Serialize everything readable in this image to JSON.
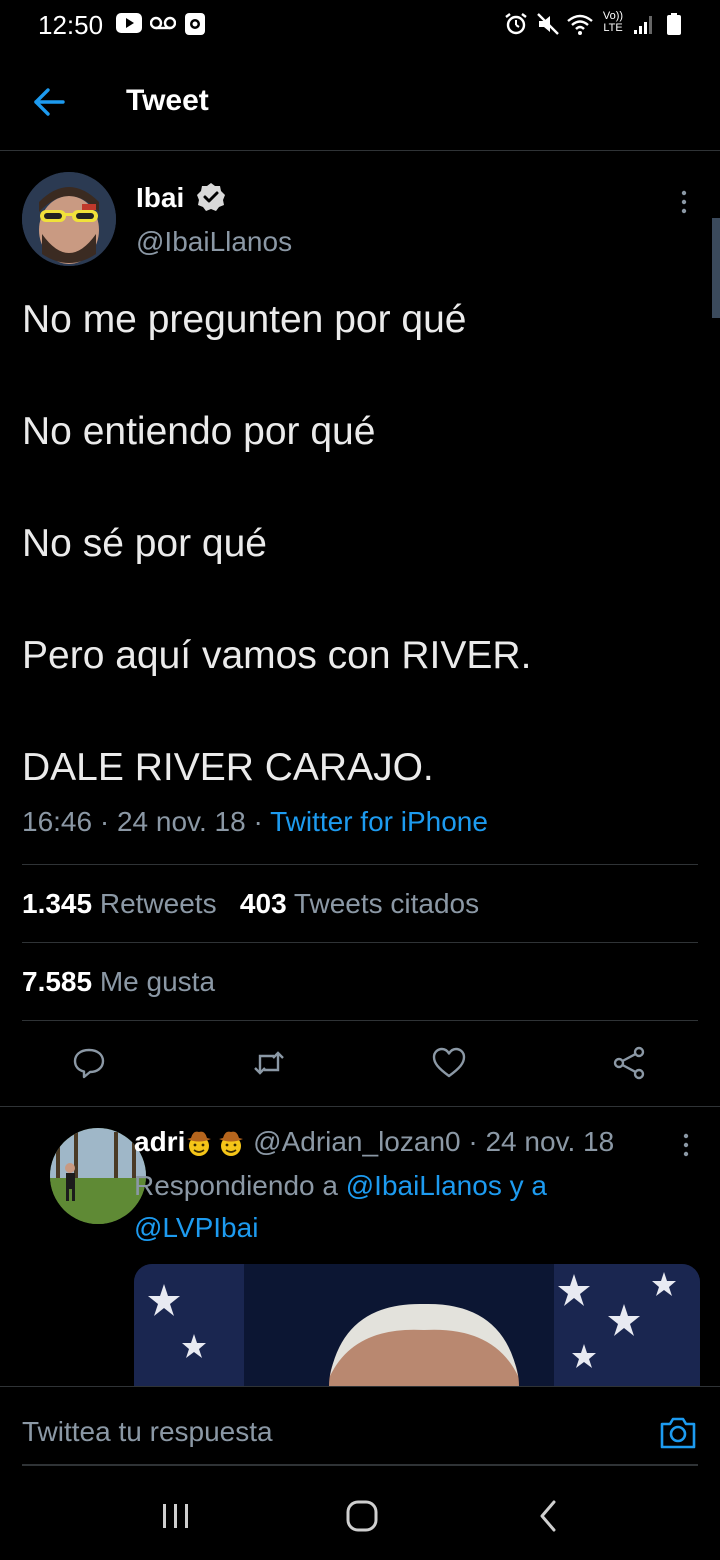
{
  "status_bar": {
    "time": "12:50",
    "lte_label": "Vo)) LTE"
  },
  "header": {
    "title": "Tweet"
  },
  "tweet": {
    "author_name": "Ibai",
    "handle": "@IbaiLlanos",
    "lines": [
      "No me pregunten por qué",
      "No entiendo por qué",
      "No sé por qué",
      "Pero aquí vamos con RIVER.",
      "DALE RIVER CARAJO."
    ],
    "time": "16:46",
    "date": "24 nov. 18",
    "source": "Twitter for iPhone",
    "retweets_count": "1.345",
    "retweets_label": "Retweets",
    "quotes_count": "403",
    "quotes_label": "Tweets citados",
    "likes_count": "7.585",
    "likes_label": "Me gusta"
  },
  "reply": {
    "name": "adri",
    "handle": "@Adrian_lozan0",
    "date": "24 nov. 18",
    "replying_prefix": "Respondiendo a",
    "replying_to_1": "@IbaiLlanos y a",
    "replying_to_2": "@LVPIbai"
  },
  "composer": {
    "placeholder": "Twittea tu respuesta"
  },
  "colors": {
    "accent": "#1d9bf0",
    "background": "#000000",
    "muted": "#8b98a5"
  }
}
